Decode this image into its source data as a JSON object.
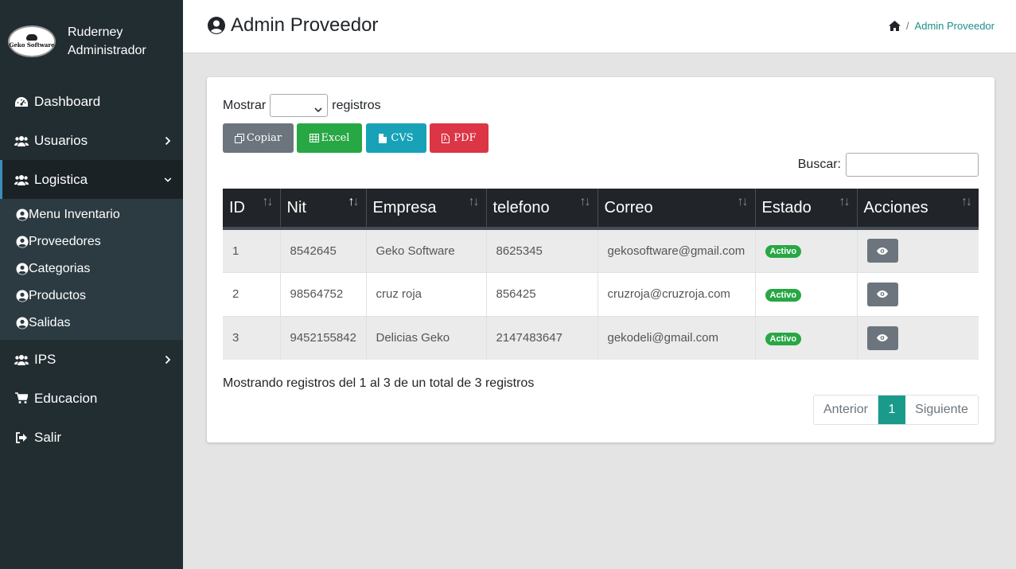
{
  "sidebar": {
    "logo_text": "Geko Software",
    "user_name": "Ruderney",
    "user_role": "Administrador",
    "items": [
      {
        "label": "Dashboard",
        "icon": "dashboard-icon"
      },
      {
        "label": "Usuarios",
        "icon": "users-icon"
      },
      {
        "label": "Logistica",
        "icon": "users-icon"
      },
      {
        "label": "IPS",
        "icon": "users-icon"
      },
      {
        "label": "Educacion",
        "icon": "cart-icon"
      },
      {
        "label": "Salir",
        "icon": "sign-out-icon"
      }
    ],
    "submenu": [
      {
        "label": "Menu Inventario"
      },
      {
        "label": "Proveedores"
      },
      {
        "label": "Categorias"
      },
      {
        "label": "Productos"
      },
      {
        "label": "Salidas"
      }
    ]
  },
  "header": {
    "title": "Admin Proveedor",
    "breadcrumb": "Admin Proveedor"
  },
  "controls": {
    "show_prefix": "Mostrar",
    "show_suffix": "registros",
    "show_value": "",
    "buttons": {
      "copy": "Copiar",
      "excel": "Excel",
      "cvs": "CVS",
      "pdf": "PDF"
    },
    "search_label": "Buscar:",
    "search_value": ""
  },
  "table": {
    "columns": [
      "ID",
      "Nit",
      "Empresa",
      "telefono",
      "Correo",
      "Estado",
      "Acciones"
    ],
    "rows": [
      {
        "id": "1",
        "nit": "8542645",
        "empresa": "Geko Software",
        "telefono": "8625345",
        "correo": "gekosoftware@gmail.com",
        "estado": "Activo"
      },
      {
        "id": "2",
        "nit": "98564752",
        "empresa": "cruz roja",
        "telefono": "856425",
        "correo": "cruzroja@cruzroja.com",
        "estado": "Activo"
      },
      {
        "id": "3",
        "nit": "9452155842",
        "empresa": "Delicias Geko",
        "telefono": "2147483647",
        "correo": "gekodeli@gmail.com",
        "estado": "Activo"
      }
    ]
  },
  "footer": {
    "info": "Mostrando registros del 1 al 3 de un total de 3 registros",
    "prev": "Anterior",
    "page": "1",
    "next": "Siguiente"
  },
  "colors": {
    "sidebar_bg": "#222d32",
    "active_page": "#1a9a8a",
    "badge_green": "#28a745"
  }
}
